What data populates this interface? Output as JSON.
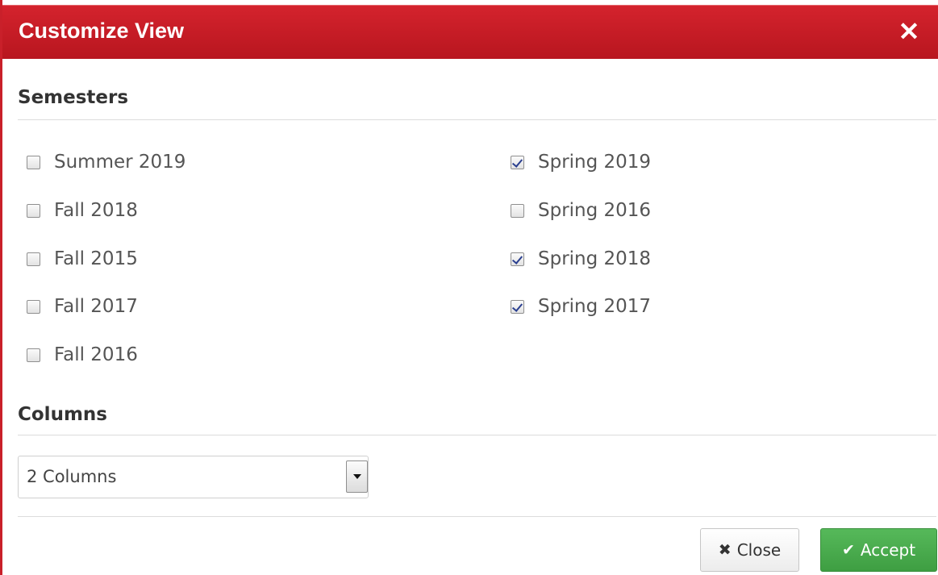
{
  "dialog": {
    "title": "Customize View",
    "close_glyph": "✕",
    "close_icon": "close-icon"
  },
  "semesters": {
    "heading": "Semesters",
    "items": [
      {
        "label": "Summer 2019",
        "checked": false
      },
      {
        "label": "Spring 2019",
        "checked": true
      },
      {
        "label": "Fall 2018",
        "checked": false
      },
      {
        "label": "Spring 2016",
        "checked": false
      },
      {
        "label": "Fall 2015",
        "checked": false
      },
      {
        "label": "Spring 2018",
        "checked": true
      },
      {
        "label": "Fall 2017",
        "checked": false
      },
      {
        "label": "Spring 2017",
        "checked": true
      },
      {
        "label": "Fall 2016",
        "checked": false
      }
    ]
  },
  "columns": {
    "heading": "Columns",
    "selected": "2 Columns"
  },
  "footer": {
    "close_label": "Close",
    "close_icon_glyph": "✖",
    "accept_label": "Accept",
    "accept_icon_glyph": "✔"
  },
  "colors": {
    "title_bar": "#c9202a",
    "accept_button": "#4cae4f"
  }
}
